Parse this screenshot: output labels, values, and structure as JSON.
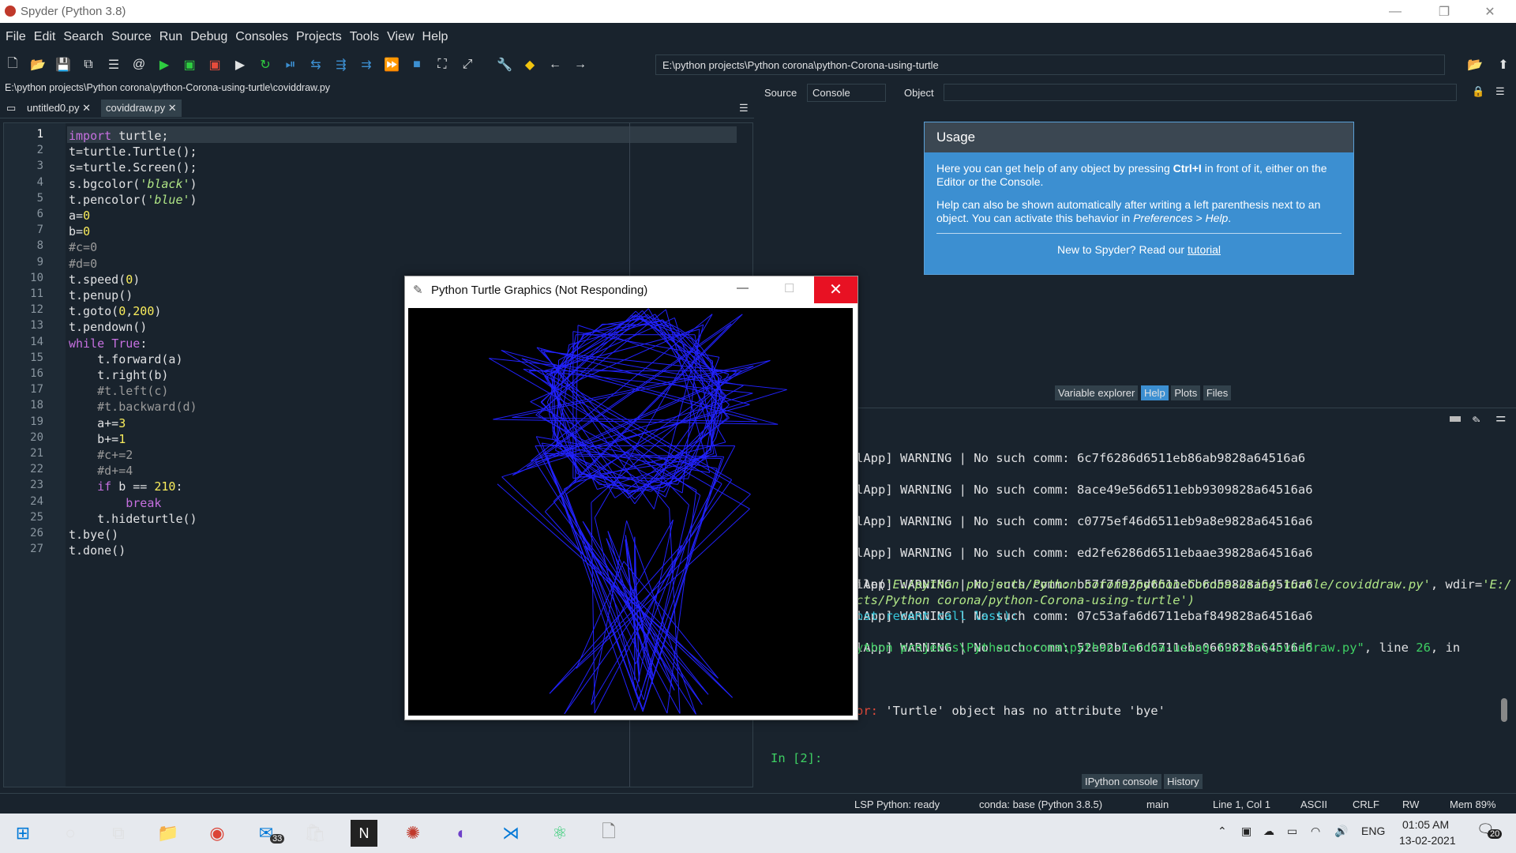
{
  "window": {
    "title": "Spyder (Python 3.8)"
  },
  "menu": [
    "File",
    "Edit",
    "Search",
    "Source",
    "Run",
    "Debug",
    "Consoles",
    "Projects",
    "Tools",
    "View",
    "Help"
  ],
  "toolbar": {
    "path": "E:\\python projects\\Python corona\\python-Corona-using-turtle"
  },
  "editor": {
    "file_path": "E:\\python projects\\Python corona\\python-Corona-using-turtle\\coviddraw.py",
    "tabs": [
      "untitled0.py",
      "coviddraw.py"
    ],
    "line_numbers": [
      "1",
      "2",
      "3",
      "4",
      "5",
      "6",
      "7",
      "8",
      "9",
      "10",
      "11",
      "12",
      "13",
      "14",
      "15",
      "16",
      "17",
      "18",
      "19",
      "20",
      "21",
      "22",
      "23",
      "24",
      "25",
      "26",
      "27"
    ]
  },
  "help": {
    "source_label": "Source",
    "source_value": "Console",
    "object_label": "Object",
    "usage_title": "Usage",
    "p1a": "Here you can get help of any object by pressing ",
    "p1b": "Ctrl+I",
    "p1c": " in front of it, either on the Editor or the Console.",
    "p2a": "Help can also be shown automatically after writing a left parenthesis next to an object. You can activate this behavior in ",
    "p2b": "Preferences > Help",
    "p2c": ".",
    "new_a": "New to Spyder? Read our ",
    "new_link": "tutorial",
    "tabs": [
      "Variable explorer",
      "Help",
      "Plots",
      "Files"
    ]
  },
  "console": {
    "warnings": [
      "lApp] WARNING | No such comm: 6c7f6286d6511eb86ab9828a64516a6",
      "lApp] WARNING | No such comm: 8ace49e56d6511ebb9309828a64516a6",
      "lApp] WARNING | No such comm: c0775ef46d6511eb9a8e9828a64516a6",
      "lApp] WARNING | No such comm: ed2fe6286d6511ebaae39828a64516a6",
      "lApp] WARNING | No such comm: b57f7f936d6611ebb6d59828a64516a6",
      "lApp] WARNING | No such comm: 07c53afa6d6711ebaf849828a64516a6",
      "lApp] WARNING | No such comm: 52e92b1e6d6711eba0669828a64516a6"
    ],
    "runfile_a": "ile(",
    "runfile_b": "'E:/python projects/Python corona/python-Corona-using-turtle/coviddraw.py'",
    "runfile_c": ", wdir=",
    "runfile_d": "'E:/",
    "runfile2": "cts/Python corona/python-Corona-using-turtle')",
    "traceback": "ost recent call last):",
    "fileline_a": "ython projects\\Python corona\\python-Corona-using-turtle\\coviddraw.py\"",
    "fileline_b": ", line ",
    "fileline_c": "26",
    "fileline_d": ", in",
    "error_a": "or:",
    "error_b": " 'Turtle' object has no attribute 'bye'",
    "prompt": "In [2]:",
    "tabs": [
      "IPython console",
      "History"
    ]
  },
  "turtle_window": {
    "title": "Python Turtle Graphics (Not Responding)"
  },
  "statusbar": {
    "lsp": "LSP Python: ready",
    "conda": "conda: base (Python 3.8.5)",
    "branch": "main",
    "position": "Line 1, Col 1",
    "encoding": "ASCII",
    "eol": "CRLF",
    "rw": "RW",
    "mem": "Mem 89%"
  },
  "taskbar": {
    "mail_badge": "33",
    "lang": "ENG",
    "time": "01:05 AM",
    "date": "13-02-2021",
    "notif": "20"
  },
  "colors": {
    "bg": "#19232d",
    "usage": "#3c8fd1",
    "line": "#2222ff"
  }
}
